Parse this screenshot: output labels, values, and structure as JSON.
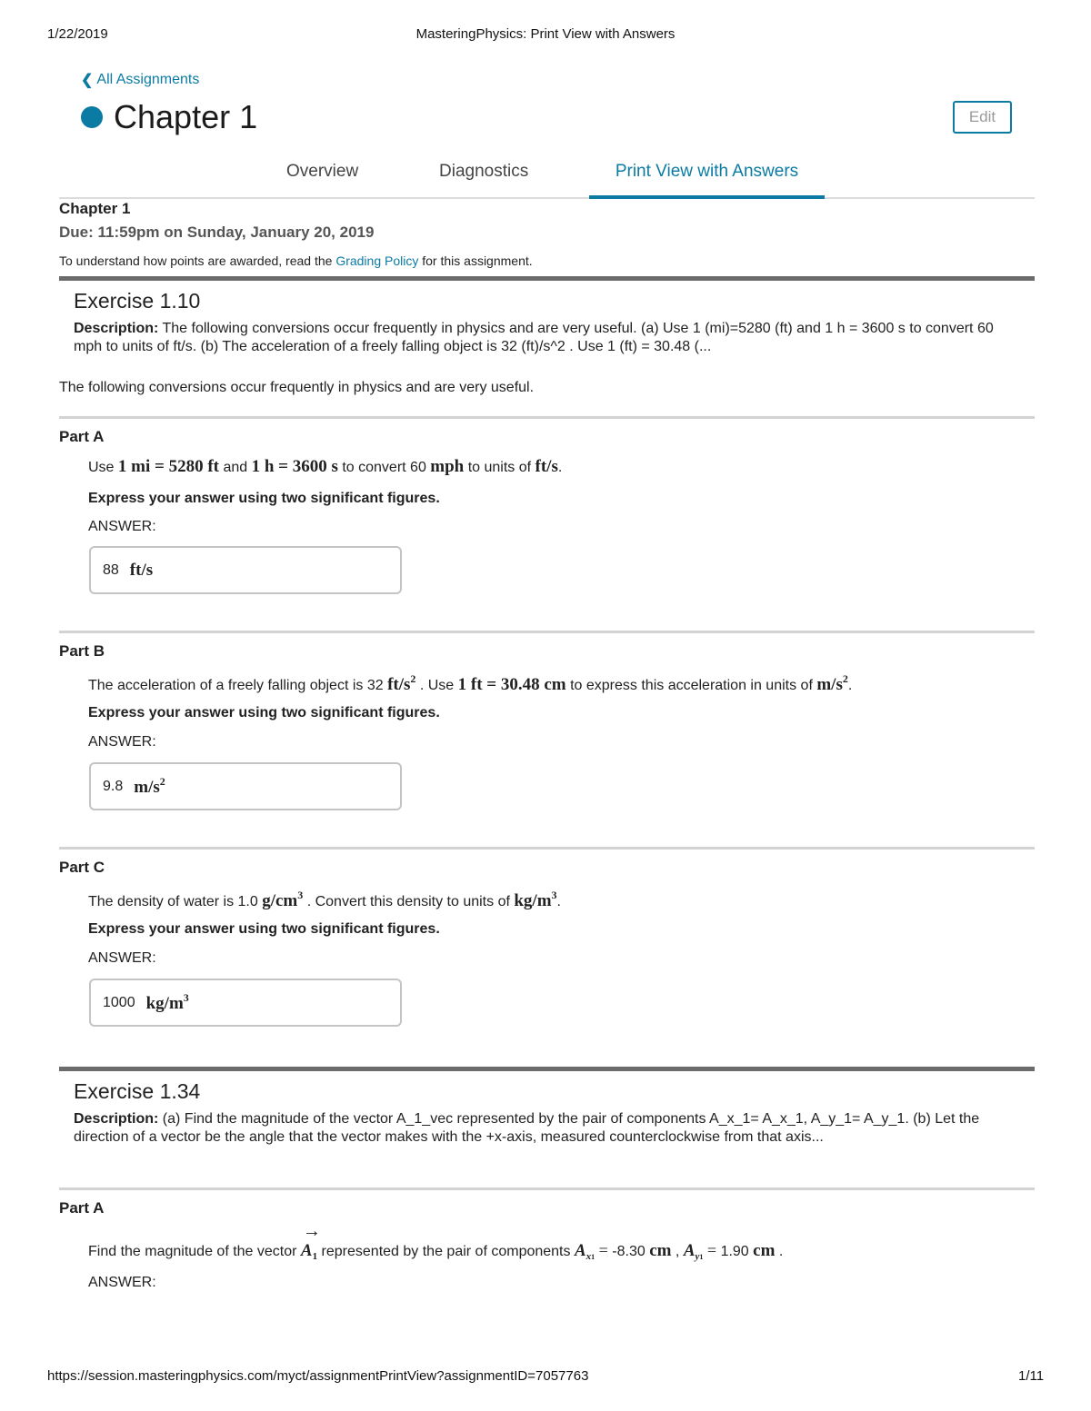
{
  "print_header": {
    "date": "1/22/2019",
    "title": "MasteringPhysics: Print View with Answers"
  },
  "nav": {
    "back_chevron": "❮",
    "back_link": "All Assignments",
    "chapter_title": "Chapter 1",
    "edit_button": "Edit",
    "accent_color": "#0b7ba3"
  },
  "tabs": [
    {
      "label": "Overview",
      "active": false
    },
    {
      "label": "Diagnostics",
      "active": false
    },
    {
      "label": "Print View with Answers",
      "active": true
    }
  ],
  "assignment": {
    "name": "Chapter 1",
    "due": "Due: 11:59pm on Sunday, January 20, 2019",
    "policy_prefix": "To understand how points are awarded, read the ",
    "policy_link": "Grading Policy",
    "policy_suffix": " for this assignment."
  },
  "exercises": [
    {
      "title": "Exercise 1.10",
      "description_label": "Description:",
      "description_line1": " The following conversions occur frequently in physics and are very useful. (a) Use 1 (mi)=5280 (ft) and 1 h = 3600 s to convert 60",
      "description_line2": "mph to units of ft/s. (b) The acceleration of a freely falling object is 32 (ft)/s^2 . Use 1 (ft) = 30.48 (...",
      "intro": "The following conversions occur frequently in physics and are very useful.",
      "parts": [
        {
          "label": "Part A",
          "q": {
            "t1": "Use ",
            "m1": "1 mi = 5280 ft",
            "t2": " and ",
            "m2": "1 h = 3600 s",
            "t3": " to convert 60 ",
            "m3": "mph",
            "t4": " to units of ",
            "m4": "ft/s",
            "t5": "."
          },
          "instruction": "Express your answer using two significant figures.",
          "answer_label": "ANSWER:",
          "answer_value": "88",
          "answer_unit": "ft/s"
        },
        {
          "label": "Part B",
          "q": {
            "t1": "The acceleration of a freely falling object is 32 ",
            "m1": "ft/s",
            "sup1": "2",
            "t2": " . Use ",
            "m2": "1 ft = 30.48 cm",
            "t3": " to express this acceleration in units of ",
            "m3": "m/s",
            "sup3": "2",
            "t4": "."
          },
          "instruction": "Express your answer using two significant figures.",
          "answer_label": "ANSWER:",
          "answer_value": "9.8",
          "answer_unit": "m/s",
          "answer_unit_sup": "2"
        },
        {
          "label": "Part C",
          "q": {
            "t1": "The density of water is 1.0 ",
            "m1": "g/cm",
            "sup1": "3",
            "t2": " . Convert this density to units of ",
            "m2": "kg/m",
            "sup2": "3",
            "t3": "."
          },
          "instruction": "Express your answer using two significant figures.",
          "answer_label": "ANSWER:",
          "answer_value": "1000",
          "answer_unit": "kg/m",
          "answer_unit_sup": "3"
        }
      ]
    },
    {
      "title": "Exercise 1.34",
      "description_label": "Description:",
      "description_line1": " (a) Find the magnitude of the vector A_1_vec represented by the pair of components A_x_1= A_x_1, A_y_1= A_y_1. (b) Let the",
      "description_line2": "direction of a vector be the angle that the vector makes with the +x-axis, measured counterclockwise from that axis...",
      "parts": [
        {
          "label": "Part A",
          "q": {
            "t1": "Find the magnitude of the vector ",
            "vec_arrow": "→",
            "vec_sym": "A",
            "vec_sub": "1",
            "t2": " represented by the pair of components ",
            "ax_sym": "A",
            "ax_sub": "x",
            "ax_subsub": "1",
            "eq1": " = ",
            "ax_val": "-8.30 ",
            "unit1": "cm",
            "t3": " , ",
            "ay_sym": "A",
            "ay_sub": "y",
            "ay_subsub": "1",
            "eq2": " = ",
            "ay_val": "1.90 ",
            "unit2": "cm",
            "t4": " ."
          },
          "answer_label": "ANSWER:"
        }
      ]
    }
  ],
  "footer": {
    "url": "https://session.masteringphysics.com/myct/assignmentPrintView?assignmentID=7057763",
    "page": "1/11"
  }
}
